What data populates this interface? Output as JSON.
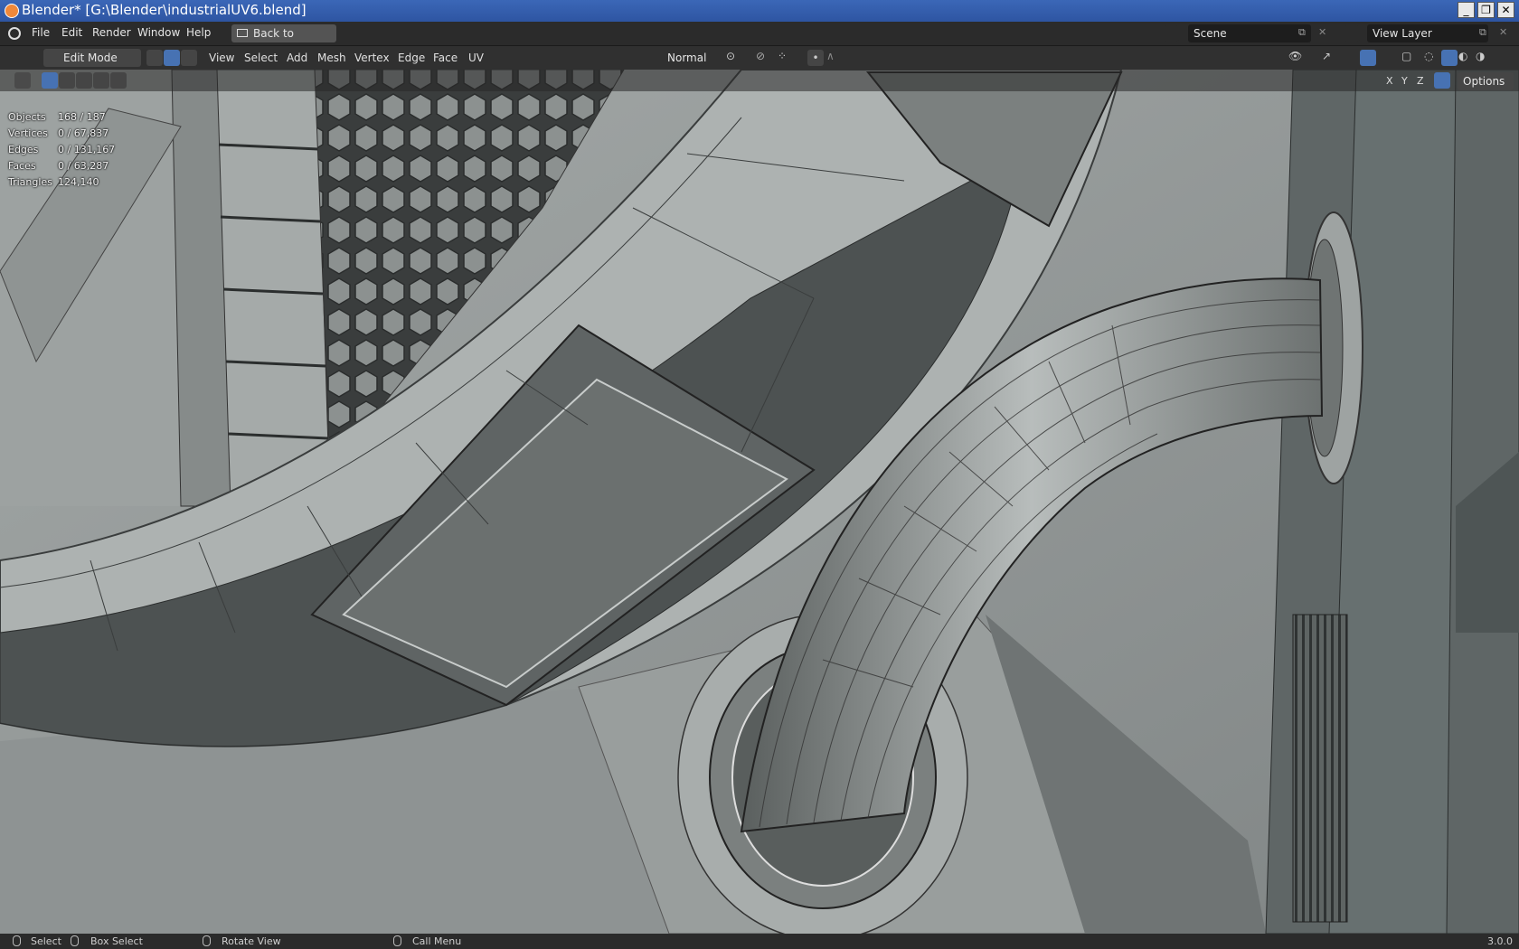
{
  "window": {
    "title": "Blender* [G:\\Blender\\industrialUV6.blend]"
  },
  "menu": {
    "file": "File",
    "edit": "Edit",
    "render": "Render",
    "window": "Window",
    "help": "Help",
    "back": "Back to Previous"
  },
  "scene": {
    "name": "Scene",
    "view_layer": "View Layer"
  },
  "header": {
    "mode": "Edit Mode",
    "view": "View",
    "select": "Select",
    "add": "Add",
    "mesh": "Mesh",
    "vertex": "Vertex",
    "edge": "Edge",
    "face": "Face",
    "uv": "UV",
    "orientation": "Normal"
  },
  "gizmo": {
    "x": "X",
    "y": "Y",
    "z": "Z",
    "options": "Options"
  },
  "stats": [
    {
      "k": "Objects",
      "v": "168 / 187"
    },
    {
      "k": "Vertices",
      "v": "0 / 67,837"
    },
    {
      "k": "Edges",
      "v": "0 / 131,167"
    },
    {
      "k": "Faces",
      "v": "0 / 63,287"
    },
    {
      "k": "Triangles",
      "v": "124,140"
    }
  ],
  "status": {
    "select": "Select",
    "box_select": "Box Select",
    "rotate": "Rotate View",
    "call_menu": "Call Menu",
    "version": "3.0.0"
  },
  "colors": {
    "title_bg": "#2e55a2",
    "active_blue": "#4772b3",
    "header_bg": "#303030",
    "mesh_grey": "#8e9493"
  }
}
